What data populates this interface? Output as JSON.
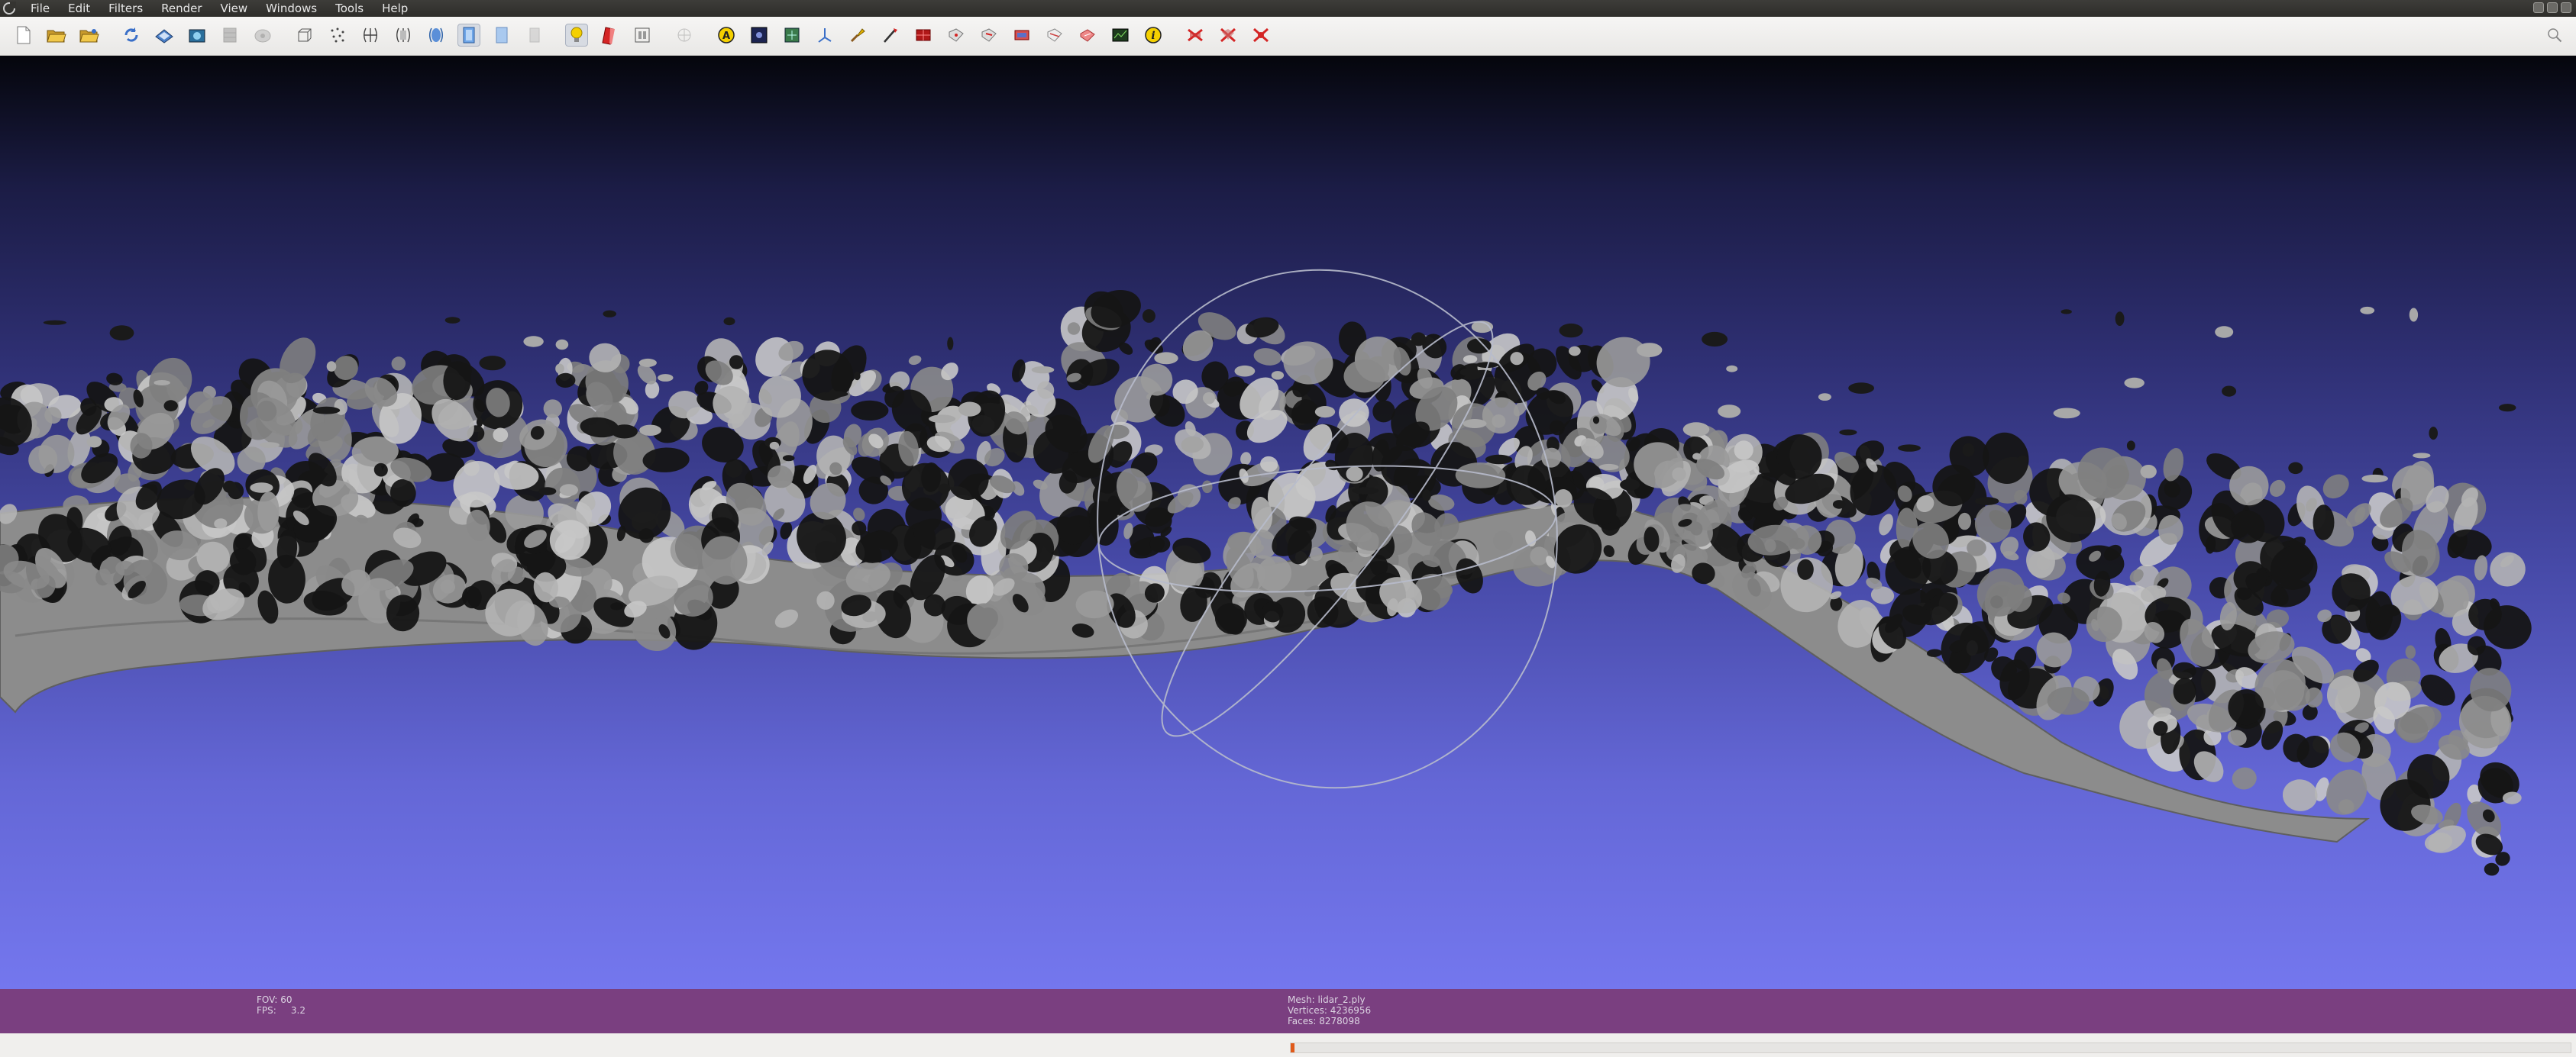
{
  "menu": {
    "items": [
      "File",
      "Edit",
      "Filters",
      "Render",
      "View",
      "Windows",
      "Tools",
      "Help"
    ]
  },
  "toolbar": {
    "icons": [
      "new-project-icon",
      "open-project-icon",
      "open-mesh-icon",
      "reload-icon",
      "save-icon",
      "snapshot-icon",
      "layer-stack-icon",
      "bounding-box-icon",
      "wireframe-icon",
      "points-icon",
      "flat-shading-icon",
      "smooth-shading-icon",
      "texture-icon",
      "light-bulb-icon",
      "backface-icon",
      "color-icon",
      "decorate-icon",
      "annotation-icon",
      "raster-icon",
      "normals-icon",
      "align-icon",
      "paint-icon",
      "z-painting-icon",
      "select-faces-icon",
      "select-vertices-icon",
      "select-connected-icon",
      "pick-points-icon",
      "measure-icon",
      "edit-reference-icon",
      "info-icon",
      "delete-faces-icon",
      "delete-vertices-icon",
      "delete-all-icon"
    ],
    "colors": {
      "accent_yellow": "#f4d000",
      "accent_red": "#d42424",
      "accent_blue": "#3a6fc8"
    }
  },
  "viewport": {
    "colors": {
      "bg_top": "#05060c",
      "bg_bottom": "#7477ee",
      "mesh_gray": "#8f8f8f",
      "mesh_dark": "#141414"
    }
  },
  "info": {
    "fov_label": "FOV:",
    "fov_value": "60",
    "fps_label": "FPS:",
    "fps_value": "3.2",
    "mesh_label": "Mesh:",
    "mesh_name": "lidar_2.ply",
    "vertices_label": "Vertices:",
    "vertices_value": "4236956",
    "faces_label": "Faces:",
    "faces_value": "8278098"
  },
  "status": {
    "progress": 0.003,
    "progress_color": "#e05a1a"
  }
}
